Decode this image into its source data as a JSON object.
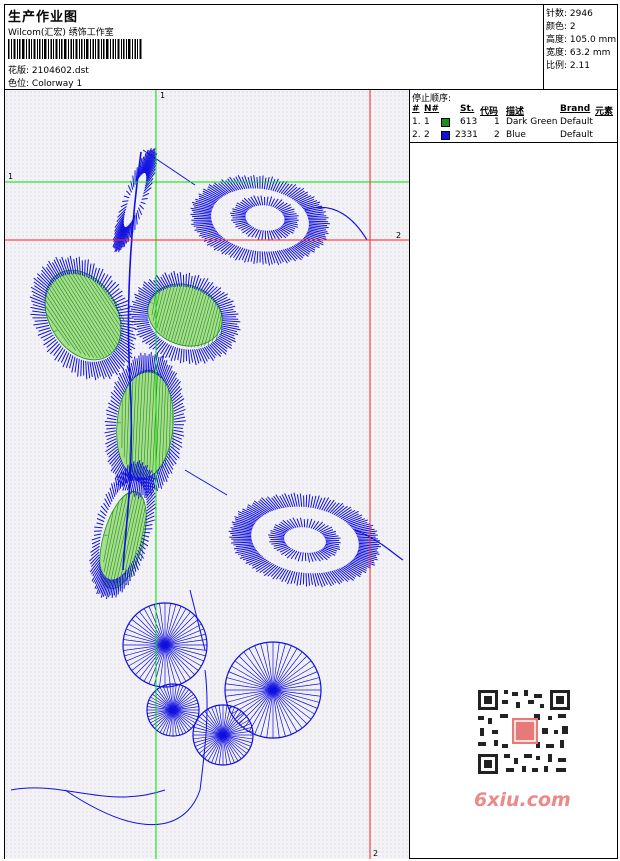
{
  "header": {
    "title": "生产作业图",
    "company": "Wilcom(汇宏) 绣饰工作室",
    "design_label": "花版:",
    "design_value": "2104602.dst",
    "colorway_label": "色位:",
    "colorway_value": "Colorway 1"
  },
  "stats": [
    {
      "label": "针数:",
      "value": "2946"
    },
    {
      "label": "颜色:",
      "value": "2"
    },
    {
      "label": "高度:",
      "value": "105.0 mm"
    },
    {
      "label": "宽度:",
      "value": "63.2 mm"
    },
    {
      "label": "比例:",
      "value": "2.11"
    }
  ],
  "stop_sequence": {
    "heading": "停止顺序:",
    "columns": [
      "#",
      "N#",
      "St.",
      "代码",
      "描述",
      "Brand",
      "元素"
    ],
    "rows": [
      {
        "num": "1.",
        "n": "1",
        "color": "#1a8f1a",
        "st": "613",
        "code": "1",
        "desc": "Dark Green",
        "brand": "Default"
      },
      {
        "num": "2.",
        "n": "2",
        "color": "#1010e0",
        "st": "2331",
        "code": "2",
        "desc": "Blue",
        "brand": "Default"
      }
    ]
  },
  "guides": {
    "green_v_label": "1",
    "green_h_label": "1",
    "red_h_label": "2",
    "red_v_label": "2"
  },
  "watermark": "6xiu.com",
  "colors": {
    "thread_green": "#1a8f1a",
    "thread_blue": "#1010e0",
    "green_fill": "#a7dd8c",
    "guide_green": "#00e000",
    "guide_red": "#ff2020",
    "watermark": "#ec8a87"
  }
}
